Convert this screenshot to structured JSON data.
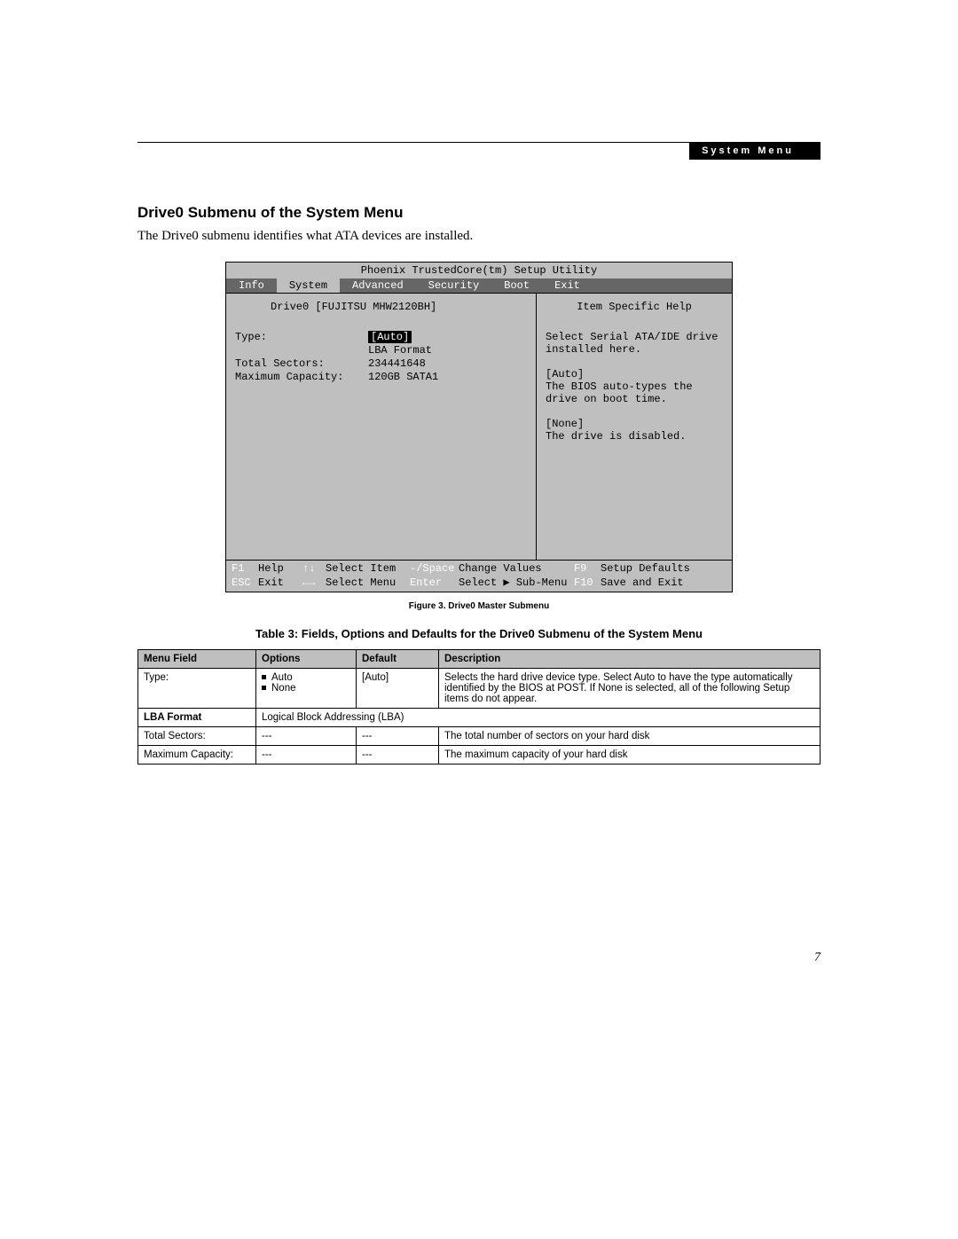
{
  "header": {
    "breadcrumb": "System Menu"
  },
  "section": {
    "title": "Drive0 Submenu of the System Menu",
    "intro": "The Drive0 submenu identifies what ATA devices are installed."
  },
  "bios": {
    "title": "Phoenix TrustedCore(tm) Setup Utility",
    "tabs": [
      "Info",
      "System",
      "Advanced",
      "Security",
      "Boot",
      "Exit"
    ],
    "active_tab_index": 1,
    "sub_title": "Drive0 [FUJITSU MHW2120BH]",
    "help_title": "Item Specific Help",
    "fields": {
      "type_label": "Type:",
      "type_value": "[Auto]",
      "lba_label": "LBA Format",
      "sectors_label": "Total Sectors:",
      "sectors_value": "234441648",
      "capacity_label": "Maximum Capacity:",
      "capacity_value": "120GB SATA1"
    },
    "help": {
      "p1": "Select Serial ATA/IDE drive installed here.",
      "p2a": "[Auto]",
      "p2b": "The BIOS auto-types the drive on boot time.",
      "p3a": "[None]",
      "p3b": "The drive is disabled."
    },
    "footer": {
      "f1": "F1",
      "help": "Help",
      "ud": "↑↓",
      "select_item": "Select Item",
      "pm": "-/Space",
      "change_values": "Change Values",
      "f9": "F9",
      "setup_defaults": "Setup Defaults",
      "esc": "ESC",
      "exit": "Exit",
      "lr": "←→",
      "select_menu": "Select Menu",
      "enter": "Enter",
      "select_sub": "Select ▶ Sub-Menu",
      "f10": "F10",
      "save_exit": "Save and Exit"
    }
  },
  "figure_caption": "Figure 3.  Drive0 Master Submenu",
  "table_title": "Table 3: Fields, Options and Defaults for the Drive0 Submenu of the System Menu",
  "table": {
    "headers": [
      "Menu Field",
      "Options",
      "Default",
      "Description"
    ],
    "rows": [
      {
        "field": "Type:",
        "options": [
          "Auto",
          "None"
        ],
        "default": "[Auto]",
        "desc": "Selects the hard drive device type. Select Auto to have the type automatically identified by the BIOS at POST. If None is selected, all of the following Setup items do not appear."
      },
      {
        "field": "LBA Format",
        "field_bold": true,
        "options": [],
        "default": "",
        "desc": "Logical Block Addressing (LBA)",
        "span_merge": true
      },
      {
        "field": "Total Sectors:",
        "options_text": "---",
        "default": "---",
        "desc": "The total number of sectors on your hard disk"
      },
      {
        "field": "Maximum Capacity:",
        "options_text": "---",
        "default": "---",
        "desc": "The maximum capacity of your hard disk"
      }
    ]
  },
  "page_number": "7"
}
